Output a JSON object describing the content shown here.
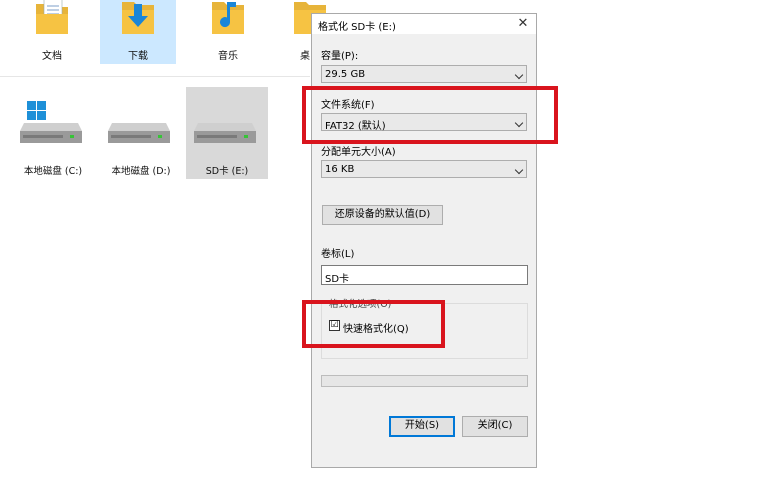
{
  "explorer": {
    "folders": [
      {
        "label": "文档",
        "icon": "document-folder-icon"
      },
      {
        "label": "下载",
        "icon": "download-folder-icon"
      },
      {
        "label": "音乐",
        "icon": "music-folder-icon"
      },
      {
        "label": "桌",
        "icon": "desktop-folder-icon"
      }
    ],
    "drives": [
      {
        "label": "本地磁盘 (C:)",
        "icon": "system-drive-icon"
      },
      {
        "label": "本地磁盘 (D:)",
        "icon": "drive-icon"
      },
      {
        "label": "SD卡 (E:)",
        "icon": "drive-icon"
      }
    ]
  },
  "dialog": {
    "title": "格式化 SD卡 (E:)",
    "close_glyph": "✕",
    "capacity_label": "容量(P):",
    "capacity_value": "29.5 GB",
    "filesystem_label": "文件系统(F)",
    "filesystem_value": "FAT32 (默认)",
    "allocation_label": "分配单元大小(A)",
    "allocation_value": "16 KB",
    "restore_defaults_label": "还原设备的默认值(D)",
    "volume_label_label": "卷标(L)",
    "volume_label_value": "SD卡",
    "format_options_label": "格式化选项(O)",
    "quick_format_label": "快速格式化(Q)",
    "quick_format_checked": "☑",
    "start_label": "开始(S)",
    "close_label": "关闭(C)"
  },
  "colors": {
    "highlight": "#d9141d",
    "selection": "#cce8ff",
    "folder_yellow": "#f6c343",
    "accent_blue": "#0078d7"
  }
}
